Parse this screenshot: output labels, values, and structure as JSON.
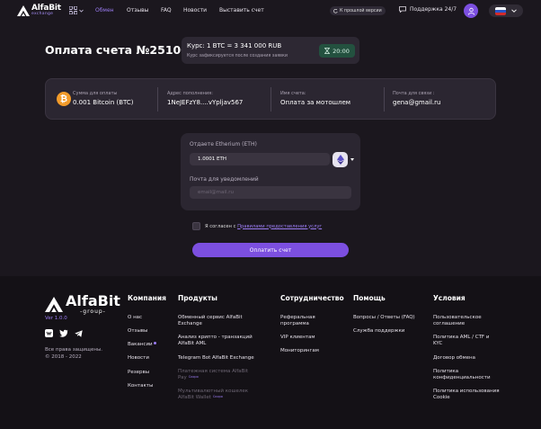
{
  "header": {
    "logo": {
      "name": "AlfaBit",
      "sub": "exchange"
    },
    "nav": [
      "Обмен",
      "Отзывы",
      "FAQ",
      "Новости",
      "Выставить счет"
    ],
    "prev_version": "К прошлой версии",
    "support": "Поддержка 24/7",
    "language": "ru"
  },
  "main": {
    "title": "Оплата счета №251008",
    "rate": {
      "label": "Курс: 1 BTC = 3 341 000 RUB",
      "note": "Курс зафиксируется после создания заявки",
      "timer": "20:00"
    },
    "info": [
      {
        "label": "Сумма для оплаты",
        "value": "0.001 Bitcoin (BTC)"
      },
      {
        "label": "Адрес пополнения:",
        "value": "1NeJEFzY8....vYpljav567"
      },
      {
        "label": "Имя счета:",
        "value": "Оплата за мотошлем"
      },
      {
        "label": "Почта для связи :",
        "value": "gena@gmail.ru"
      }
    ],
    "form": {
      "give_label": "Отдаете Etherium (ETH)",
      "give_value": "1.0001 ETH",
      "email_label": "Почта для уведомлений",
      "email_placeholder": "email@mail.ru"
    },
    "agree": {
      "text": "Я согласен с",
      "link": "Правилами предоставления услуг"
    },
    "pay_button": "Оплатить счет"
  },
  "footer": {
    "logo": {
      "name": "AlfaBit",
      "sub": "-group-"
    },
    "version": "Ver 1.0.0",
    "rights": [
      "Все права защищены.",
      "© 2018 - 2022"
    ],
    "columns": [
      {
        "title": "Компания",
        "items": [
          "О нас",
          "Отзывы",
          "Вакансии",
          "Новости",
          "Резервы",
          "Контакты"
        ]
      },
      {
        "title": "Продукты",
        "items": [
          "Обменный сервис AlfaBit Exchange",
          "Анализ крипто - транзакций AlfaBit AML",
          "Telegram Bot AlfaBit Exchange",
          "Платежная система AlfaBit Pay",
          "Мультивалютный кошелек AlfaBit Wallet"
        ],
        "badge": "Скоро"
      },
      {
        "title": "Сотрудничество",
        "items": [
          "Реферальная программа",
          "VIP клиентам",
          "Мониторингам"
        ]
      },
      {
        "title": "Помощь",
        "items": [
          "Вопросы / Ответы (FAQ)",
          "Служба поддержки"
        ]
      },
      {
        "title": "Условия",
        "items": [
          "Пользовательское соглашение",
          "Политика AML / CTF и KYC",
          "Договор обмена",
          "Политика конфиденциальности",
          "Политика использования Cookie"
        ]
      }
    ]
  },
  "colors": {
    "accent": "#7c4fe0",
    "link": "#9b7cf3",
    "timer_bg": "#23513f",
    "bitcoin": "#f29b2a"
  }
}
